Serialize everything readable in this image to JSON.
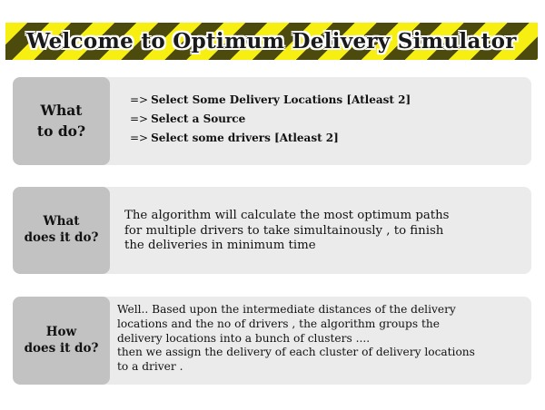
{
  "banner": {
    "title": "Welcome to Optimum Delivery Simulator"
  },
  "cards": [
    {
      "label": "What\nto do?",
      "steps": [
        {
          "arrow": "=>",
          "text": "Select Some Delivery Locations [Atleast 2]"
        },
        {
          "arrow": "=>",
          "text": "Select a Source"
        },
        {
          "arrow": "=>",
          "text": "Select some drivers [Atleast 2]"
        }
      ]
    },
    {
      "label": "What\ndoes it do?",
      "text": "The algorithm will calculate the most optimum paths\nfor multiple drivers to take simultainously , to finish\nthe deliveries in minimum time"
    },
    {
      "label": "How\ndoes it do?",
      "text": "Well.. Based upon the intermediate distances of the delivery\nlocations and the no of drivers , the algorithm  groups the\ndelivery locations into a bunch of clusters ....\nthen we assign the delivery of each cluster of delivery locations\nto a driver ."
    }
  ]
}
